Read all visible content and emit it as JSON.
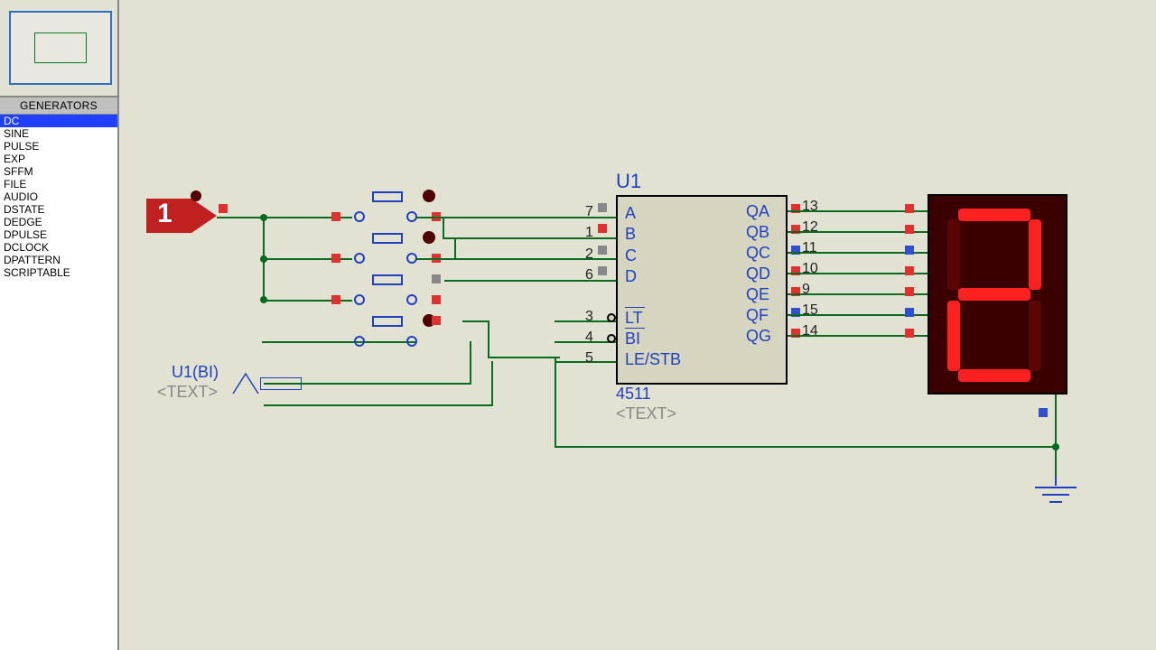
{
  "sidebar": {
    "section_title": "GENERATORS",
    "items": [
      "DC",
      "SINE",
      "PULSE",
      "EXP",
      "SFFM",
      "FILE",
      "AUDIO",
      "DSTATE",
      "DEDGE",
      "DPULSE",
      "DCLOCK",
      "DPATTERN",
      "SCRIPTABLE"
    ],
    "selected_index": 0
  },
  "generator": {
    "name": "U1(BI)",
    "placeholder": "<TEXT>",
    "badge": "1"
  },
  "ic": {
    "ref": "U1",
    "part": "4511",
    "placeholder": "<TEXT>",
    "left_pins": [
      {
        "num": "7",
        "name": "A"
      },
      {
        "num": "1",
        "name": "B"
      },
      {
        "num": "2",
        "name": "C"
      },
      {
        "num": "6",
        "name": "D"
      },
      {
        "num": "3",
        "name": "LT",
        "inv": true
      },
      {
        "num": "4",
        "name": "BI",
        "inv": true
      },
      {
        "num": "5",
        "name": "LE/STB"
      }
    ],
    "right_pins": [
      {
        "num": "13",
        "name": "QA"
      },
      {
        "num": "12",
        "name": "QB"
      },
      {
        "num": "11",
        "name": "QC"
      },
      {
        "num": "10",
        "name": "QD"
      },
      {
        "num": "9",
        "name": "QE"
      },
      {
        "num": "15",
        "name": "QF"
      },
      {
        "num": "14",
        "name": "QG"
      }
    ],
    "right_states": [
      "r",
      "r",
      "b",
      "r",
      "r",
      "b",
      "r"
    ]
  },
  "display": {
    "digit": "2",
    "segments": {
      "a": true,
      "b": true,
      "c": false,
      "d": true,
      "e": true,
      "f": false,
      "g": true
    }
  }
}
